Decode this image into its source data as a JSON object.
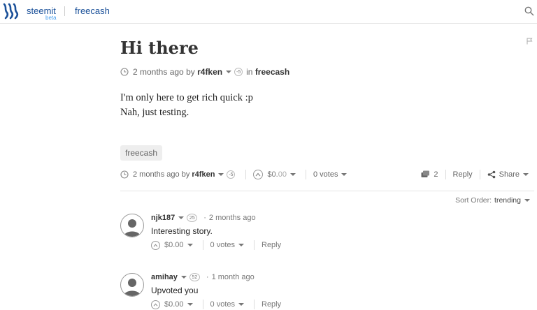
{
  "header": {
    "brand": "steemit",
    "beta": "beta",
    "tag": "freecash"
  },
  "post": {
    "title": "Hi there",
    "time": "2 months ago",
    "by": "by",
    "author": "r4fken",
    "reputation": "-5",
    "in_label": "in",
    "category": "freecash",
    "body_lines": [
      "I'm only here to get rich quick :p",
      "Nah, just testing."
    ],
    "tag": "freecash",
    "footer": {
      "time": "2 months ago",
      "by": "by",
      "author": "r4fken",
      "reputation": "-5",
      "payout_dollars": "$0.",
      "payout_cents": "00",
      "votes": "0 votes",
      "comment_count": "2",
      "reply_label": "Reply",
      "share_label": "Share"
    }
  },
  "sort": {
    "label": "Sort Order:",
    "value": "trending"
  },
  "comments": [
    {
      "author": "njk187",
      "reputation": "25",
      "time": "2 months ago",
      "text": "Interesting story.",
      "payout": "$0.00",
      "votes": "0 votes",
      "reply_label": "Reply"
    },
    {
      "author": "amihay",
      "reputation": "52",
      "time": "1 month ago",
      "text": "Upvoted you",
      "payout": "$0.00",
      "votes": "0 votes",
      "reply_label": "Reply"
    }
  ]
}
